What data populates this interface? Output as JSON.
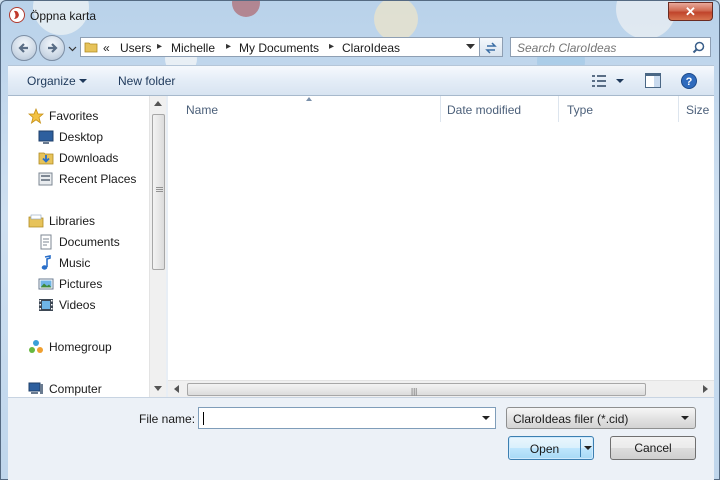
{
  "window": {
    "title": "Öppna karta",
    "close_symbol": "✕",
    "icons": {
      "app": "claroideas-app-icon",
      "close": "close-icon"
    }
  },
  "navigation": {
    "back_icon": "back-arrow-icon",
    "forward_icon": "forward-arrow-icon",
    "recent_icon": "chevron-down-icon",
    "address": {
      "overflow": "«",
      "parts": [
        "Users",
        "Michelle",
        "My Documents",
        "ClaroIdeas"
      ],
      "separator": "▸",
      "folder_icon": "folder-icon",
      "dropdown_icon": "chevron-down-icon"
    },
    "refresh_icon": "refresh-icon",
    "search": {
      "placeholder": "Search ClaroIdeas",
      "icon": "search-icon"
    }
  },
  "toolbar": {
    "organize": "Organize",
    "new_folder": "New folder",
    "view_icon": "view-list-icon",
    "preview_icon": "preview-pane-icon",
    "help_icon": "help-icon"
  },
  "nav_pane": {
    "favorites": {
      "label": "Favorites",
      "icon": "star-icon",
      "items": [
        {
          "label": "Desktop",
          "icon": "desktop-icon"
        },
        {
          "label": "Downloads",
          "icon": "downloads-icon"
        },
        {
          "label": "Recent Places",
          "icon": "recent-places-icon"
        }
      ]
    },
    "libraries": {
      "label": "Libraries",
      "icon": "libraries-icon",
      "items": [
        {
          "label": "Documents",
          "icon": "documents-icon"
        },
        {
          "label": "Music",
          "icon": "music-icon"
        },
        {
          "label": "Pictures",
          "icon": "pictures-icon"
        },
        {
          "label": "Videos",
          "icon": "videos-icon"
        }
      ]
    },
    "homegroup": {
      "label": "Homegroup",
      "icon": "homegroup-icon"
    },
    "computer": {
      "label": "Computer",
      "icon": "computer-icon"
    }
  },
  "file_pane": {
    "columns": [
      "Name",
      "Date modified",
      "Type",
      "Size"
    ],
    "rows": [],
    "scroll_grip": "|||"
  },
  "footer": {
    "file_name_label": "File name:",
    "file_name_value": "",
    "filter": "ClaroIdeas filer (*.cid)",
    "open_label": "Open",
    "cancel_label": "Cancel"
  },
  "colors": {
    "accent": "#3c7fb1",
    "toolbar_text": "#1e395b",
    "close_button": "#c0442b"
  }
}
